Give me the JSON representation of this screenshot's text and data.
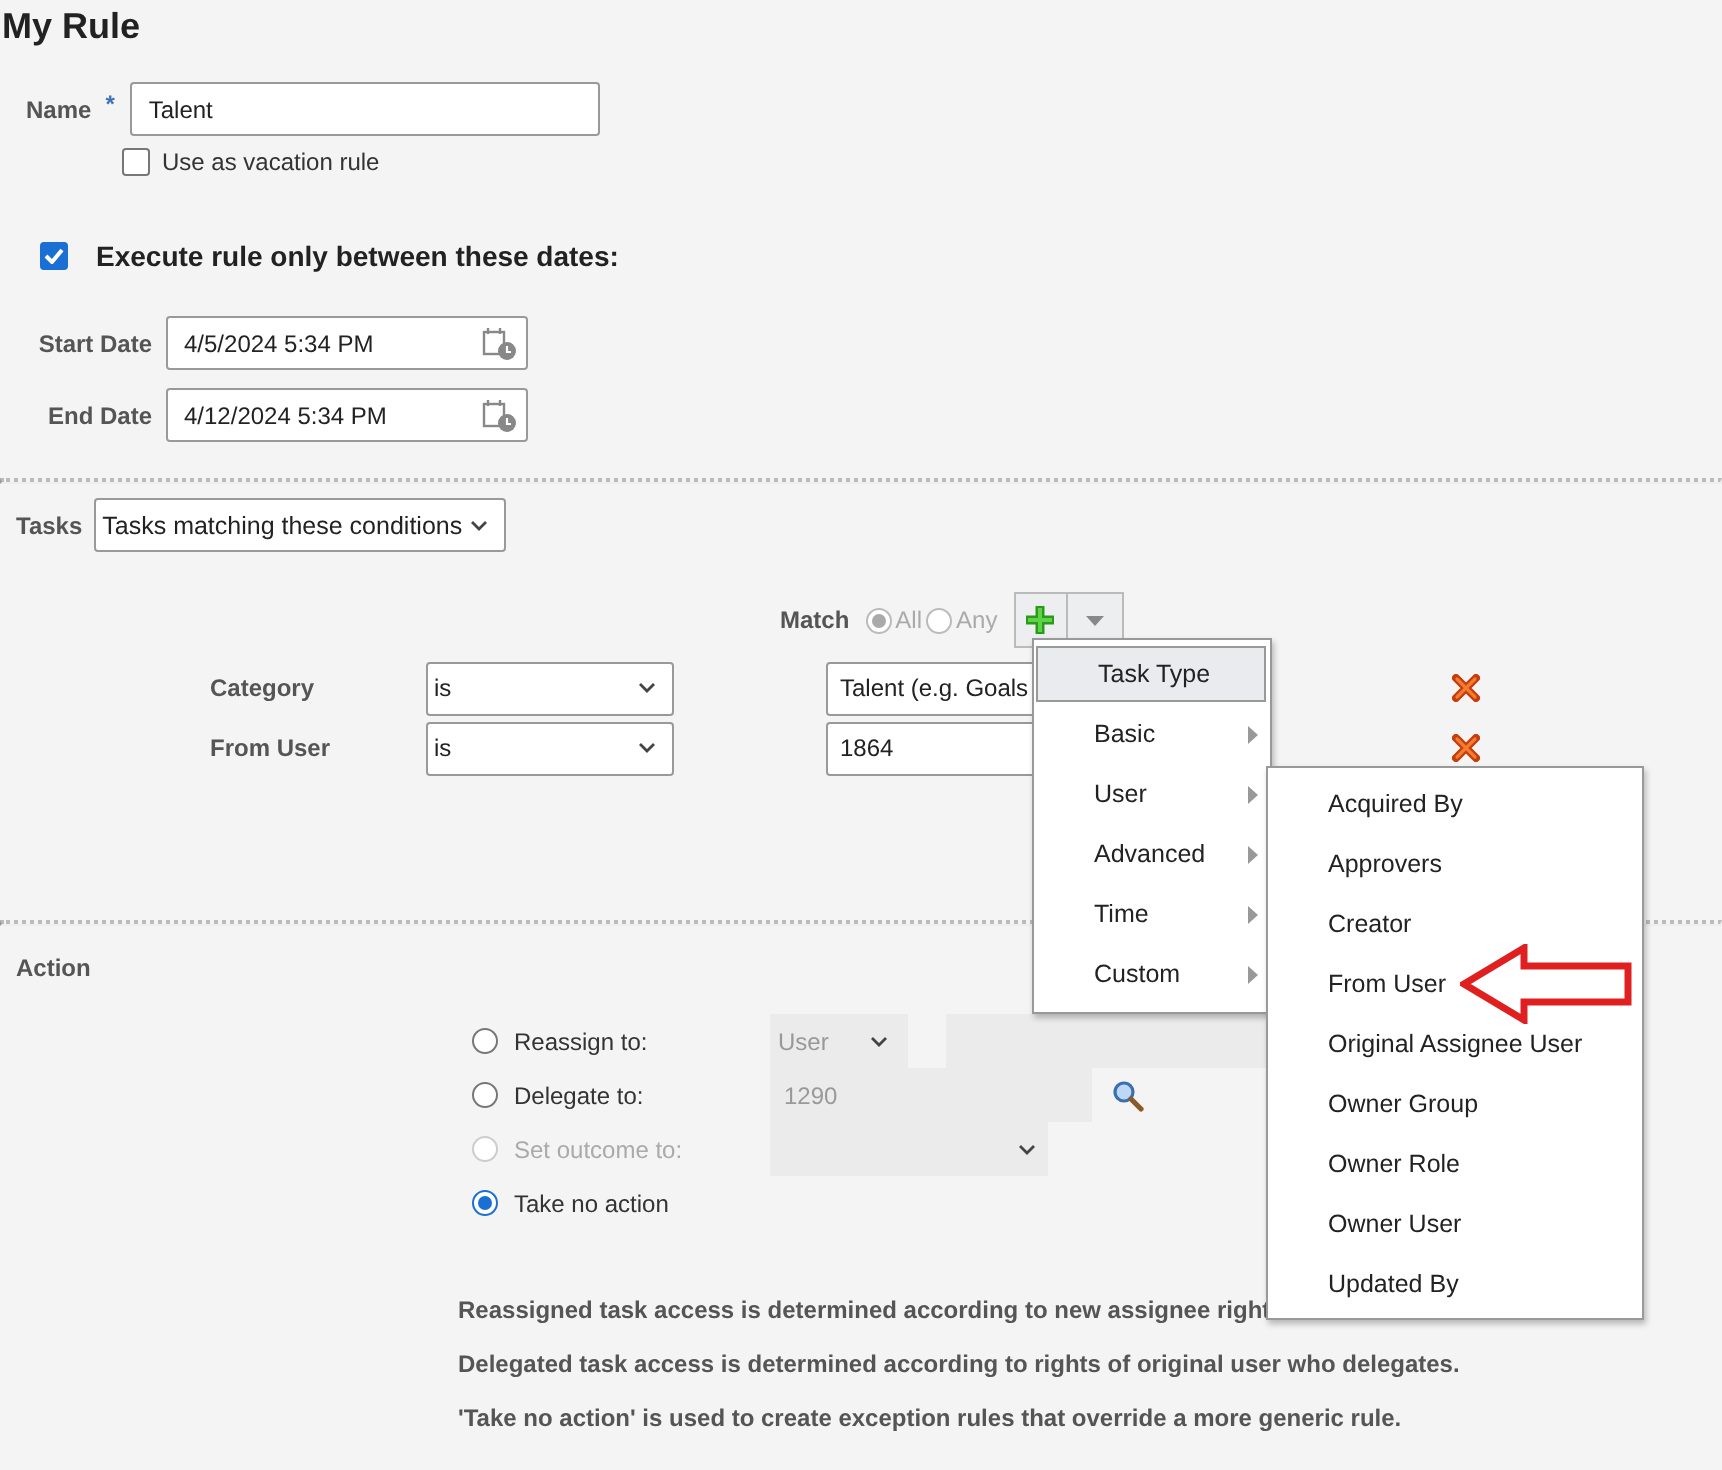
{
  "title": "My Rule",
  "name_field": {
    "label": "Name",
    "required_mark": "*",
    "value": "Talent"
  },
  "vacation_rule": {
    "label": "Use as vacation rule",
    "checked": false
  },
  "date_range": {
    "label": "Execute rule only between these dates:",
    "checked": true
  },
  "dates": [
    {
      "label": "Start Date",
      "value": "4/5/2024 5:34 PM"
    },
    {
      "label": "End Date",
      "value": "4/12/2024 5:34 PM"
    }
  ],
  "tasks": {
    "label": "Tasks",
    "value": "Tasks matching these conditions"
  },
  "match": {
    "label": "Match",
    "options": [
      {
        "label": "All",
        "selected": true
      },
      {
        "label": "Any",
        "selected": false
      }
    ]
  },
  "conditions": [
    {
      "label": "Category",
      "operator": "is",
      "value": "Talent (e.g. Goals"
    },
    {
      "label": "From User",
      "operator": "is",
      "value": "1864"
    }
  ],
  "action": {
    "label": "Action",
    "options": [
      {
        "kind": "reassign",
        "label": "Reassign to:",
        "selected": false,
        "disabled": false,
        "field": "User"
      },
      {
        "kind": "delegate",
        "label": "Delegate to:",
        "selected": false,
        "disabled": false,
        "field": "1290"
      },
      {
        "kind": "outcome",
        "label": "Set outcome to:",
        "selected": false,
        "disabled": true
      },
      {
        "kind": "none",
        "label": "Take no action",
        "selected": true,
        "disabled": false
      }
    ]
  },
  "notes": [
    "Reassigned task access is determined according to new assignee right",
    "Delegated task access is determined according to rights of original user who delegates.",
    "'Take no action' is used to create exception rules that override a more generic rule."
  ],
  "add_menu": {
    "items": [
      {
        "label": "Task Type",
        "selected": true,
        "has_submenu": false
      },
      {
        "label": "Basic",
        "selected": false,
        "has_submenu": true
      },
      {
        "label": "User",
        "selected": false,
        "has_submenu": true
      },
      {
        "label": "Advanced",
        "selected": false,
        "has_submenu": true
      },
      {
        "label": "Time",
        "selected": false,
        "has_submenu": true
      },
      {
        "label": "Custom",
        "selected": false,
        "has_submenu": true
      }
    ]
  },
  "user_submenu": {
    "items": [
      "Acquired By",
      "Approvers",
      "Creator",
      "From User",
      "Original Assignee User",
      "Owner Group",
      "Owner Role",
      "Owner User",
      "Updated By"
    ]
  }
}
